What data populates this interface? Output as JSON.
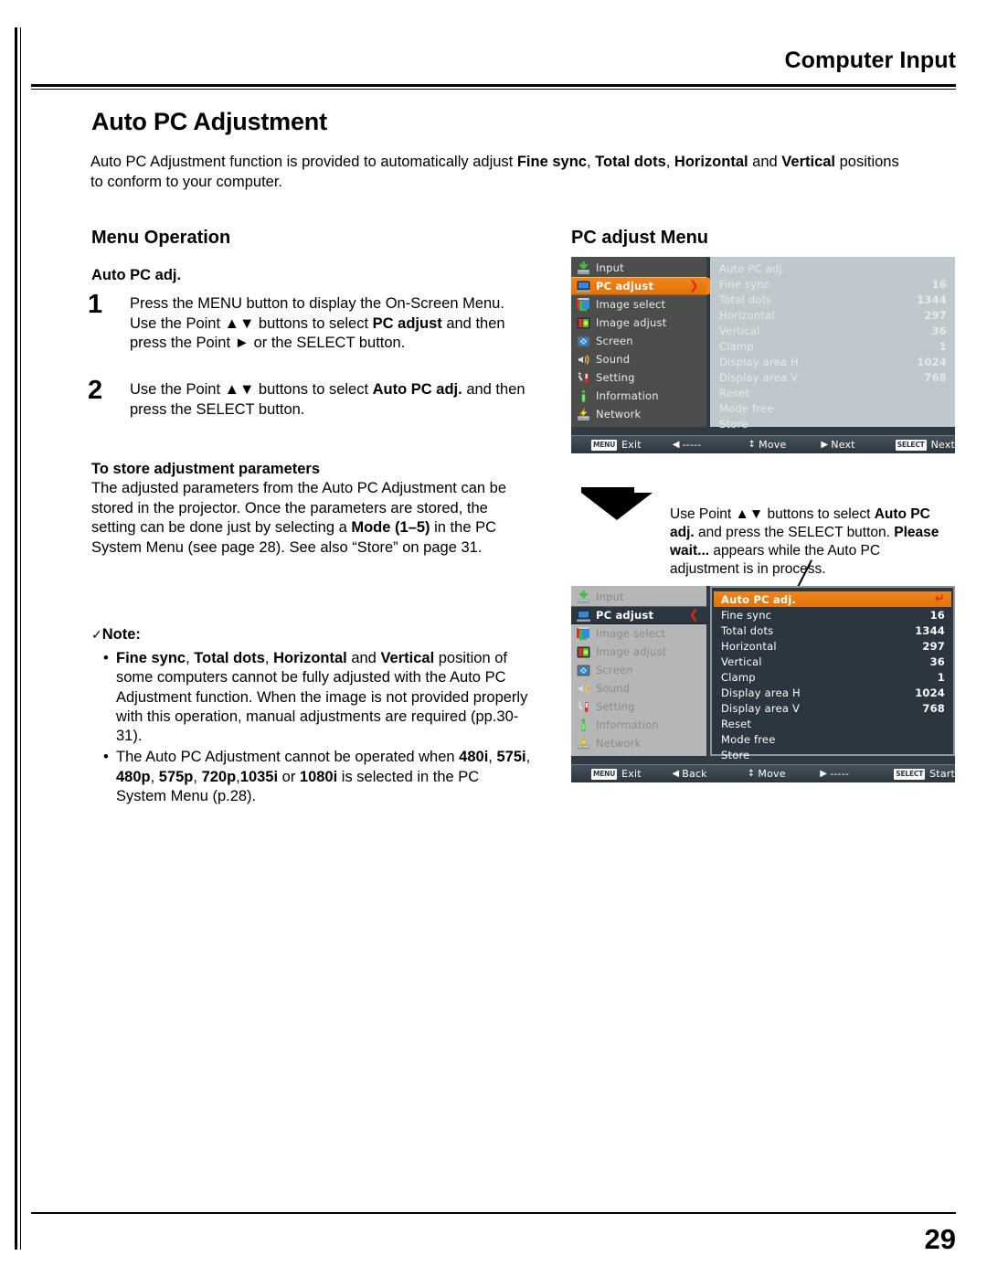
{
  "header": {
    "section_title": "Computer Input"
  },
  "footer": {
    "page_number": "29"
  },
  "document": {
    "title": "Auto PC Adjustment",
    "intro_prefix": "Auto PC Adjustment function is provided to automatically adjust ",
    "intro_b1": "Fine sync",
    "intro_sep1": ", ",
    "intro_b2": "Total dots",
    "intro_sep2": ", ",
    "intro_b3": "Horizontal",
    "intro_mid": " and ",
    "intro_b4": "Vertical",
    "intro_suffix": " positions to conform to your computer."
  },
  "left_column": {
    "section_heading": "Menu Operation",
    "subheading": "Auto PC adj.",
    "steps": [
      {
        "number": "1",
        "text_a": "Press the MENU button to display the On-Screen Menu. Use the Point ",
        "updown": "▲▼",
        "text_b": " buttons to select ",
        "bold": "PC adjust",
        "text_c": " and then press the Point ",
        "right": "►",
        "text_d": " or the SELECT button."
      },
      {
        "number": "2",
        "text_a": "Use the Point ",
        "updown": "▲▼",
        "text_b": " buttons to select ",
        "bold": "Auto PC adj.",
        "text_c": " and then press the SELECT button.",
        "right": "",
        "text_d": ""
      }
    ],
    "store": {
      "heading": "To store adjustment parameters",
      "body_a": "The adjusted parameters from the Auto PC Adjustment can be stored in the projector. Once the parameters are stored, the setting can be done just by selecting a ",
      "body_bold": "Mode (1–5)",
      "body_b": " in the PC System Menu (see page 28). See also “Store” on page 31."
    },
    "note": {
      "check": "✓",
      "label": "Note:",
      "bullet": "•",
      "item1_b1": "Fine sync",
      "item1_s1": ", ",
      "item1_b2": "Total dots",
      "item1_s2": ", ",
      "item1_b3": "Horizontal",
      "item1_s3": " and ",
      "item1_b4": "Vertical",
      "item1_rest": " position of some computers cannot be fully adjusted with the Auto PC Adjustment function. When the image is not provided properly with this operation, manual adjustments are required (pp.30-31).",
      "item2_a": "The Auto PC Adjustment cannot be operated when ",
      "item2_b1": "480i",
      "item2_s1": ", ",
      "item2_b2": "575i",
      "item2_s2": ", ",
      "item2_b3": "480p",
      "item2_s3": ", ",
      "item2_b4": "575p",
      "item2_s4": ", ",
      "item2_b5": "720p",
      "item2_s5": ",",
      "item2_b6": "1035i",
      "item2_s6": " or ",
      "item2_b7": "1080i",
      "item2_rest": " is selected in the PC System Menu (p.28)."
    }
  },
  "right_column": {
    "section_heading": "PC adjust Menu",
    "arrow_icon": "down-arrow-icon",
    "caption": {
      "a": "Use Point ",
      "updown": "▲▼",
      "b": " buttons to select  ",
      "bold1": "Auto PC adj.",
      "c": " and press the SELECT button. ",
      "bold2": "Please wait...",
      "d": " appears while the Auto PC adjustment is in process."
    }
  },
  "osd_menu_1": {
    "sidebar": [
      {
        "label": "Input",
        "icon": "input-icon",
        "selected": false,
        "arrow": ""
      },
      {
        "label": "PC adjust",
        "icon": "pc-adjust-icon",
        "selected": true,
        "arrow": "❯"
      },
      {
        "label": "Image select",
        "icon": "image-select-icon",
        "selected": false,
        "arrow": ""
      },
      {
        "label": "Image adjust",
        "icon": "image-adjust-icon",
        "selected": false,
        "arrow": ""
      },
      {
        "label": "Screen",
        "icon": "screen-icon",
        "selected": false,
        "arrow": ""
      },
      {
        "label": "Sound",
        "icon": "sound-icon",
        "selected": false,
        "arrow": ""
      },
      {
        "label": "Setting",
        "icon": "setting-icon",
        "selected": false,
        "arrow": ""
      },
      {
        "label": "Information",
        "icon": "information-icon",
        "selected": false,
        "arrow": ""
      },
      {
        "label": "Network",
        "icon": "network-icon",
        "selected": false,
        "arrow": ""
      }
    ],
    "items": [
      {
        "name": "Auto PC adj.",
        "value": "",
        "highlighted": false
      },
      {
        "name": "Fine sync",
        "value": "16",
        "highlighted": false
      },
      {
        "name": "Total dots",
        "value": "1344",
        "highlighted": false
      },
      {
        "name": "Horizontal",
        "value": "297",
        "highlighted": false
      },
      {
        "name": "Vertical",
        "value": "36",
        "highlighted": false
      },
      {
        "name": "Clamp",
        "value": "1",
        "highlighted": false
      },
      {
        "name": "Display area H",
        "value": "1024",
        "highlighted": false
      },
      {
        "name": "Display area V",
        "value": "768",
        "highlighted": false
      },
      {
        "name": "Reset",
        "value": "",
        "highlighted": false
      },
      {
        "name": "Mode free",
        "value": "",
        "highlighted": false
      },
      {
        "name": "Store",
        "value": "",
        "highlighted": false
      }
    ],
    "statusbar": [
      {
        "key": "MENU",
        "glyph": "",
        "label": "Exit"
      },
      {
        "key": "",
        "glyph": "◀",
        "label": "-----"
      },
      {
        "key": "",
        "glyph": "↕",
        "label": "Move"
      },
      {
        "key": "",
        "glyph": "▶",
        "label": "Next"
      },
      {
        "key": "SELECT",
        "glyph": "",
        "label": "Next"
      }
    ]
  },
  "osd_menu_2": {
    "sidebar": [
      {
        "label": "Input",
        "icon": "input-icon",
        "selected": false,
        "arrow": ""
      },
      {
        "label": "PC adjust",
        "icon": "pc-adjust-icon",
        "selected": true,
        "arrow": "❮"
      },
      {
        "label": "Image select",
        "icon": "image-select-icon",
        "selected": false,
        "arrow": ""
      },
      {
        "label": "Image adjust",
        "icon": "image-adjust-icon",
        "selected": false,
        "arrow": ""
      },
      {
        "label": "Screen",
        "icon": "screen-icon",
        "selected": false,
        "arrow": ""
      },
      {
        "label": "Sound",
        "icon": "sound-icon",
        "selected": false,
        "arrow": ""
      },
      {
        "label": "Setting",
        "icon": "setting-icon",
        "selected": false,
        "arrow": ""
      },
      {
        "label": "Information",
        "icon": "information-icon",
        "selected": false,
        "arrow": ""
      },
      {
        "label": "Network",
        "icon": "network-icon",
        "selected": false,
        "arrow": ""
      }
    ],
    "items": [
      {
        "name": "Auto PC adj.",
        "value": "↵",
        "highlighted": true
      },
      {
        "name": "Fine sync",
        "value": "16",
        "highlighted": false
      },
      {
        "name": "Total dots",
        "value": "1344",
        "highlighted": false
      },
      {
        "name": "Horizontal",
        "value": "297",
        "highlighted": false
      },
      {
        "name": "Vertical",
        "value": "36",
        "highlighted": false
      },
      {
        "name": "Clamp",
        "value": "1",
        "highlighted": false
      },
      {
        "name": "Display area H",
        "value": "1024",
        "highlighted": false
      },
      {
        "name": "Display area V",
        "value": "768",
        "highlighted": false
      },
      {
        "name": "Reset",
        "value": "",
        "highlighted": false
      },
      {
        "name": "Mode free",
        "value": "",
        "highlighted": false
      },
      {
        "name": "Store",
        "value": "",
        "highlighted": false
      }
    ],
    "statusbar": [
      {
        "key": "MENU",
        "glyph": "",
        "label": "Exit"
      },
      {
        "key": "",
        "glyph": "◀",
        "label": "Back"
      },
      {
        "key": "",
        "glyph": "↕",
        "label": "Move"
      },
      {
        "key": "",
        "glyph": "▶",
        "label": "-----"
      },
      {
        "key": "SELECT",
        "glyph": "",
        "label": "Start"
      }
    ]
  },
  "colors": {
    "osd_accent": "#e0730c",
    "osd_dark": "#2b3640",
    "osd_panel": "#bfc8cc",
    "osd_sidebar_dark": "#4d4d4d",
    "osd_sidebar_light": "#b6b6b6",
    "enter_red": "#e02b0f"
  }
}
